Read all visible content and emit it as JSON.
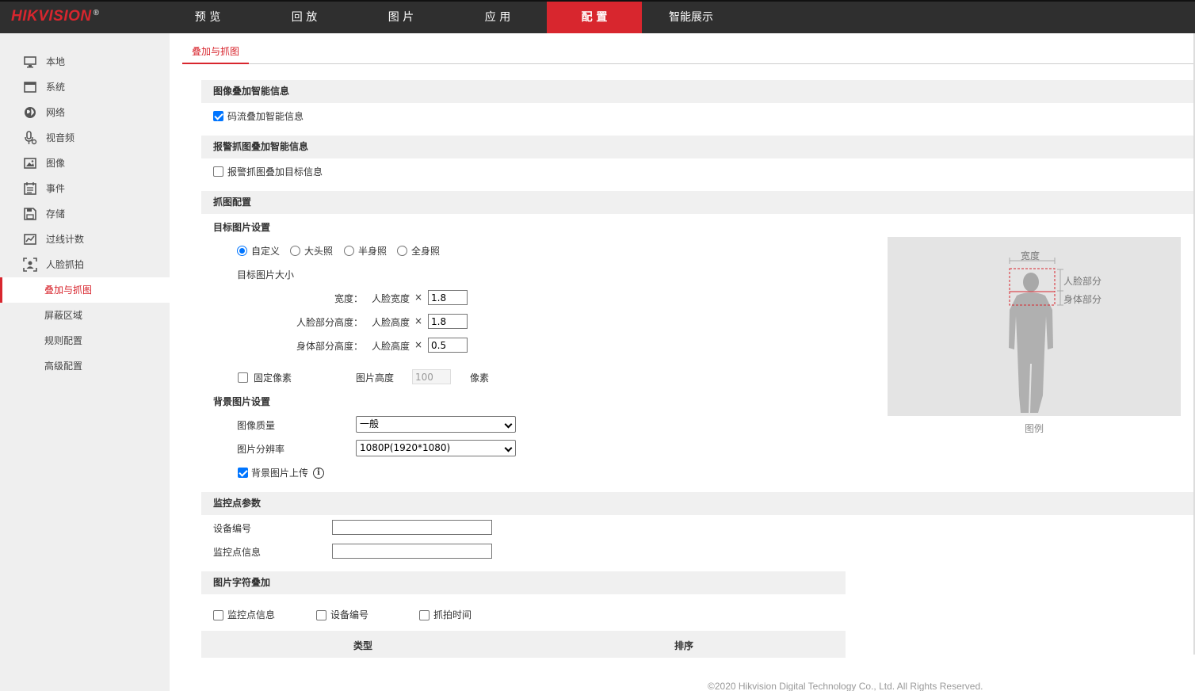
{
  "header": {
    "logo": "HIKVISION",
    "logo_mark": "®",
    "nav": [
      "预 览",
      "回 放",
      "图 片",
      "应 用",
      "配 置",
      "智能展示"
    ]
  },
  "colors": {
    "accent": "#d8262e",
    "topbar": "#2f2f2f",
    "sidebar": "#efefef",
    "checkbox": "#0075ff"
  },
  "sidebar": {
    "items": [
      {
        "label": "本地",
        "icon": "monitor-icon"
      },
      {
        "label": "系统",
        "icon": "window-icon"
      },
      {
        "label": "网络",
        "icon": "globe-icon"
      },
      {
        "label": "视音频",
        "icon": "microphone-icon"
      },
      {
        "label": "图像",
        "icon": "image-icon"
      },
      {
        "label": "事件",
        "icon": "calendar-icon"
      },
      {
        "label": "存储",
        "icon": "floppy-icon"
      },
      {
        "label": "过线计数",
        "icon": "chart-icon"
      },
      {
        "label": "人脸抓拍",
        "icon": "face-capture-icon"
      }
    ],
    "subitems": [
      "叠加与抓图",
      "屏蔽区域",
      "规则配置",
      "高级配置"
    ]
  },
  "tab": "叠加与抓图",
  "sections": {
    "smart_overlay": {
      "title": "图像叠加智能信息",
      "stream_overlay": "码流叠加智能信息",
      "stream_overlay_checked": true
    },
    "alarm_overlay": {
      "title": "报警抓图叠加智能信息",
      "target_overlay": "报警抓图叠加目标信息",
      "target_overlay_checked": false
    },
    "capture": {
      "title": "抓图配置",
      "target_settings": "目标图片设置",
      "modes": [
        "自定义",
        "大头照",
        "半身照",
        "全身照"
      ],
      "selected_mode": "自定义",
      "target_size": "目标图片大小",
      "rows": [
        {
          "label": "宽度：",
          "ref": "人脸宽度",
          "mult": "×",
          "value": "1.8"
        },
        {
          "label": "人脸部分高度：",
          "ref": "人脸高度",
          "mult": "×",
          "value": "1.8"
        },
        {
          "label": "身体部分高度：",
          "ref": "人脸高度",
          "mult": "×",
          "value": "0.5"
        }
      ],
      "fixed_pixel": "固定像素",
      "fixed_pixel_checked": false,
      "pic_height_label": "图片高度",
      "pic_height_value": "100",
      "pixel_unit": "像素",
      "bg_settings": "背景图片设置",
      "quality_label": "图像质量",
      "quality_value": "一般",
      "resolution_label": "图片分辨率",
      "resolution_value": "1080P(1920*1080)",
      "bg_upload": "背景图片上传",
      "bg_upload_checked": true
    },
    "monitor": {
      "title": "监控点参数",
      "device_no_label": "设备编号",
      "device_no_value": "",
      "point_info_label": "监控点信息",
      "point_info_value": ""
    },
    "text_overlay": {
      "title": "图片字符叠加",
      "options": [
        "监控点信息",
        "设备编号",
        "抓拍时间"
      ],
      "col_type": "类型",
      "col_order": "排序"
    }
  },
  "legend": {
    "width": "宽度",
    "face_part": "人脸部分",
    "body_part": "身体部分",
    "caption": "图例"
  },
  "footer": "©2020 Hikvision Digital Technology Co., Ltd. All Rights Reserved."
}
